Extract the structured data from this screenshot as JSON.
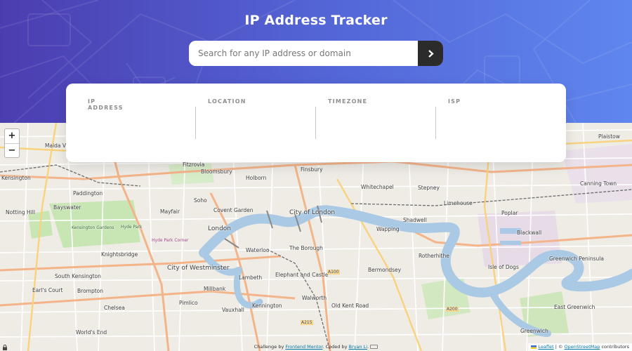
{
  "header": {
    "title": "IP Address Tracker",
    "search_placeholder": "Search for any IP address or domain",
    "search_value": "",
    "submit_icon": "chevron-right-icon"
  },
  "info": {
    "ip_address": {
      "label": "IP ADDRESS",
      "value": ""
    },
    "location": {
      "label": "LOCATION",
      "value": ""
    },
    "timezone": {
      "label": "TIMEZONE",
      "value": ""
    },
    "isp": {
      "label": "ISP",
      "value": ""
    }
  },
  "map": {
    "zoom_in": "+",
    "zoom_out": "−",
    "places": [
      "Maida Vale",
      "Fitzrovia",
      "Bloomsbury",
      "Finsbury",
      "Plaistow",
      "Kensington",
      "Paddington",
      "Holborn",
      "Whitechapel",
      "Stepney",
      "Canning Town",
      "City of London",
      "Notting Hill",
      "Bayswater",
      "Soho",
      "Limehouse",
      "Mayfair",
      "Covent Garden",
      "Poplar",
      "London",
      "Wapping",
      "Shadwell",
      "Blackwall",
      "Kensington Gardens",
      "Hyde Park",
      "Hyde Park Corner",
      "Knightsbridge",
      "Waterloo",
      "The Borough",
      "Rotherhithe",
      "Greenwich Peninsula",
      "Isle of Dogs",
      "Bermondsey",
      "City of Westminster",
      "South Kensington",
      "Elephant and Castle",
      "Lambeth",
      "Earl's Court",
      "Brompton",
      "Millbank",
      "Walworth",
      "Chelsea",
      "Pimlico",
      "Vauxhall",
      "Kennington",
      "Old Kent Road",
      "East Greenwich",
      "World's End",
      "Greenwich",
      "A100",
      "A200",
      "A215"
    ]
  },
  "footer": {
    "challenge_prefix": "Challenge by",
    "challenge_link": "Frontend Mentor",
    "coded_by": ". Coded by",
    "author_link": "Bryan Li",
    "leaflet": "Leaflet",
    "osm_prefix": "| ©",
    "osm_link": "OpenStreetMap",
    "osm_suffix": "contributors"
  },
  "colors": {
    "gradient_start": "#4b3db0",
    "gradient_end": "#5f86ee",
    "button": "#2b2b2b",
    "label_gray": "#8e8e8e"
  }
}
